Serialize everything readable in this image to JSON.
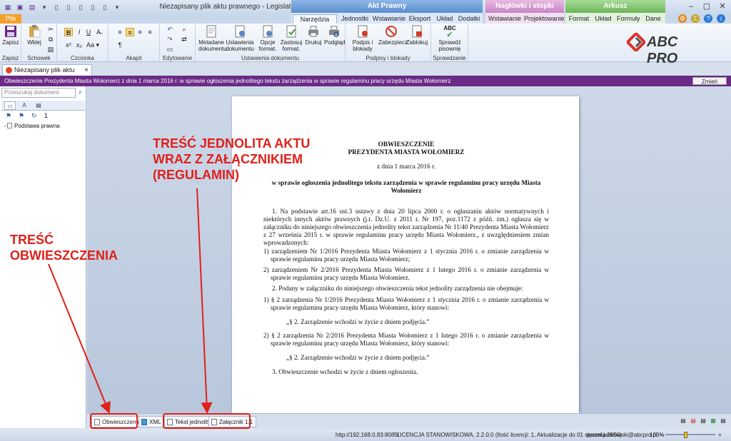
{
  "window": {
    "title": "Niezapisany plik aktu prawnego - Legislator"
  },
  "context_groups": {
    "akt": "Akt Prawny",
    "naglowki": "Nagłówki i stopki",
    "arkusz": "Arkusz"
  },
  "tabs": {
    "plik": "Plik",
    "narzedzia": "Narzędzia główne",
    "jednostki": "Jednostki",
    "wstawianie": "Wstawianie",
    "eksport": "Eksport",
    "uklad": "Układ",
    "dodatki": "Dodatki",
    "wstawianie2": "Wstawianie",
    "projektowanie": "Projektowanie",
    "format": "Format",
    "uklad2": "Układ",
    "formuly": "Formuły",
    "dane": "Dane"
  },
  "ribbon": {
    "zapisz": "Zapisz",
    "wklej": "Wklej",
    "metadane": "Metadane dokumentu",
    "ustawienia": "Ustawienia dokumentu",
    "opcje": "Opcje format.",
    "zastosuj": "Zastosuj format.",
    "drukuj": "Drukuj",
    "podglad": "Podgląd",
    "podpis": "Podpis i blokady",
    "zabezpiecz": "Zabezpiecz",
    "zablokuj": "Zablokuj",
    "sprawdz": "Sprawdź pisownię",
    "abc": "ABC",
    "groups": {
      "zapisz": "Zapisz",
      "schowek": "Schowek",
      "czcionka": "Czcionka",
      "akapit": "Akapit",
      "edytowanie": "Edytowanie",
      "ustawienia": "Ustawienia dokumentu",
      "podpisy": "Podpisy i blokady",
      "sprawdzanie": "Sprawdzanie"
    }
  },
  "logo": {
    "text": "ABC PRO"
  },
  "document_tab": {
    "label": "Niezapisany plik aktu prawnego",
    "close": "×"
  },
  "info_bar": {
    "text": "Obwieszczenie Prezydenta Miasta Wołomierz z dnia 1 marca 2016 r. w sprawie ogłoszenia jednolitego tekstu zarządzenia w sprawie regulaminu pracy urzędu Miasta Wołomierz",
    "button": "Zmień"
  },
  "left_panel": {
    "search_placeholder": "Przeszukaj dokument",
    "counter": "1",
    "tree_item": "Podstawa prawna"
  },
  "page": {
    "title1": "OBWIESZCZENIE",
    "title2": "PREZYDENTA MIASTA WOŁOMIERZ",
    "date": "z dnia 1 marca 2016 r.",
    "subject": "w sprawie ogłoszenia jednolitego tekstu zarządzenia w sprawie regulaminu pracy urzędu Miasta Wołomierz",
    "para1": "1. Na podstawie art.16 ust.3 ustawy z dnia 20 lipca 2000 r. o ogłaszaniu aktów normatywnych i niektórych innych aktów prawnych (j.t. Dz.U. z 2011 r. Nr 197, poz.1172 z późń. zm.) ogłasza się w załączniku do niniejszego obwieszczenia jednolity tekst zarządzenia Nr 11/40 Prezydenta Miasta Wołomierz z 27 września 2015 r. w sprawie regulaminu pracy urzędu Miasta Wołomierz., z uwzględnieniem zmian wprowadzonych:",
    "item1": "1) zarządzeniem Nr 1/2016 Prezydenta Miasta Wołomierz z 1 stycznia 2016 r. o zmianie zarządzenia w sprawie regulaminu pracy urzędu Miasta Wołomierz;",
    "item2": "2) zarządzeniem Nr 2/2016 Prezydenta Miasta Wołomierz z 1 lutego 2016 r. o zmianie zarządzenia w sprawie regulaminu pracy urzędu Miasta Wołomierz.",
    "para2": "2. Podany w załączniku do niniejszego obwieszczenia tekst jednolity zarządzenia nie obejmuje:",
    "item3": "1) § 2 zarządzenia Nr 1/2016 Prezydenta Miasta Wołomierz z 1 stycznia 2016 r. o zmianie zarządzenia w sprawie regulaminu pracy urzędu Miasta Wołomierz, który stanowi:",
    "quote1": "„§ 2. Zarządzenie wchodzi w życie z dniem podjęcia.”",
    "item4": "2) § 2 zarządzenia Nr 2/2016 Prezydenta Miasta Wołomierz z 1 lutego 2016 r. o zmianie zarządzenia w sprawie regulaminu pracy urzędu Miasta Wołomierz, który stanowi:",
    "quote2": "„§ 2. Zarządzenie wchodzi w życie z dniem podjęcia.”",
    "para3": "3. Obwieszczenie wchodzi w życie z dniem ogłoszenia."
  },
  "bottom_tabs": {
    "obwieszczenie": "Obwieszczenie",
    "xml": "XML",
    "tekst_jednolity": "Tekst jednolity",
    "zalacznik": "Załącznik 1.1"
  },
  "status": {
    "url": "http://192.168.0.83:8085/",
    "license": "LICENCJA STANOWISKOWA, 2.2.0.0 (Ilość licencji: 1, Aktualizacje do 01 stycznia 2050)",
    "user": "pawel.jankowski@abcpro.pl",
    "zoom": "100%"
  },
  "annotations": {
    "tresc_jednolita": [
      "TREŚĆ JEDNOLITA AKTU",
      "WRAZ Z ZAŁĄCZNIKIEM",
      "(REGULAMIN)"
    ],
    "tresc_obwieszczenia": [
      "TREŚĆ",
      "OBWIESZCZENIA"
    ]
  },
  "colors": {
    "accent_purple": "#6a2a86",
    "plik_orange": "#f2a12b",
    "annotation_red": "#e0201a"
  }
}
